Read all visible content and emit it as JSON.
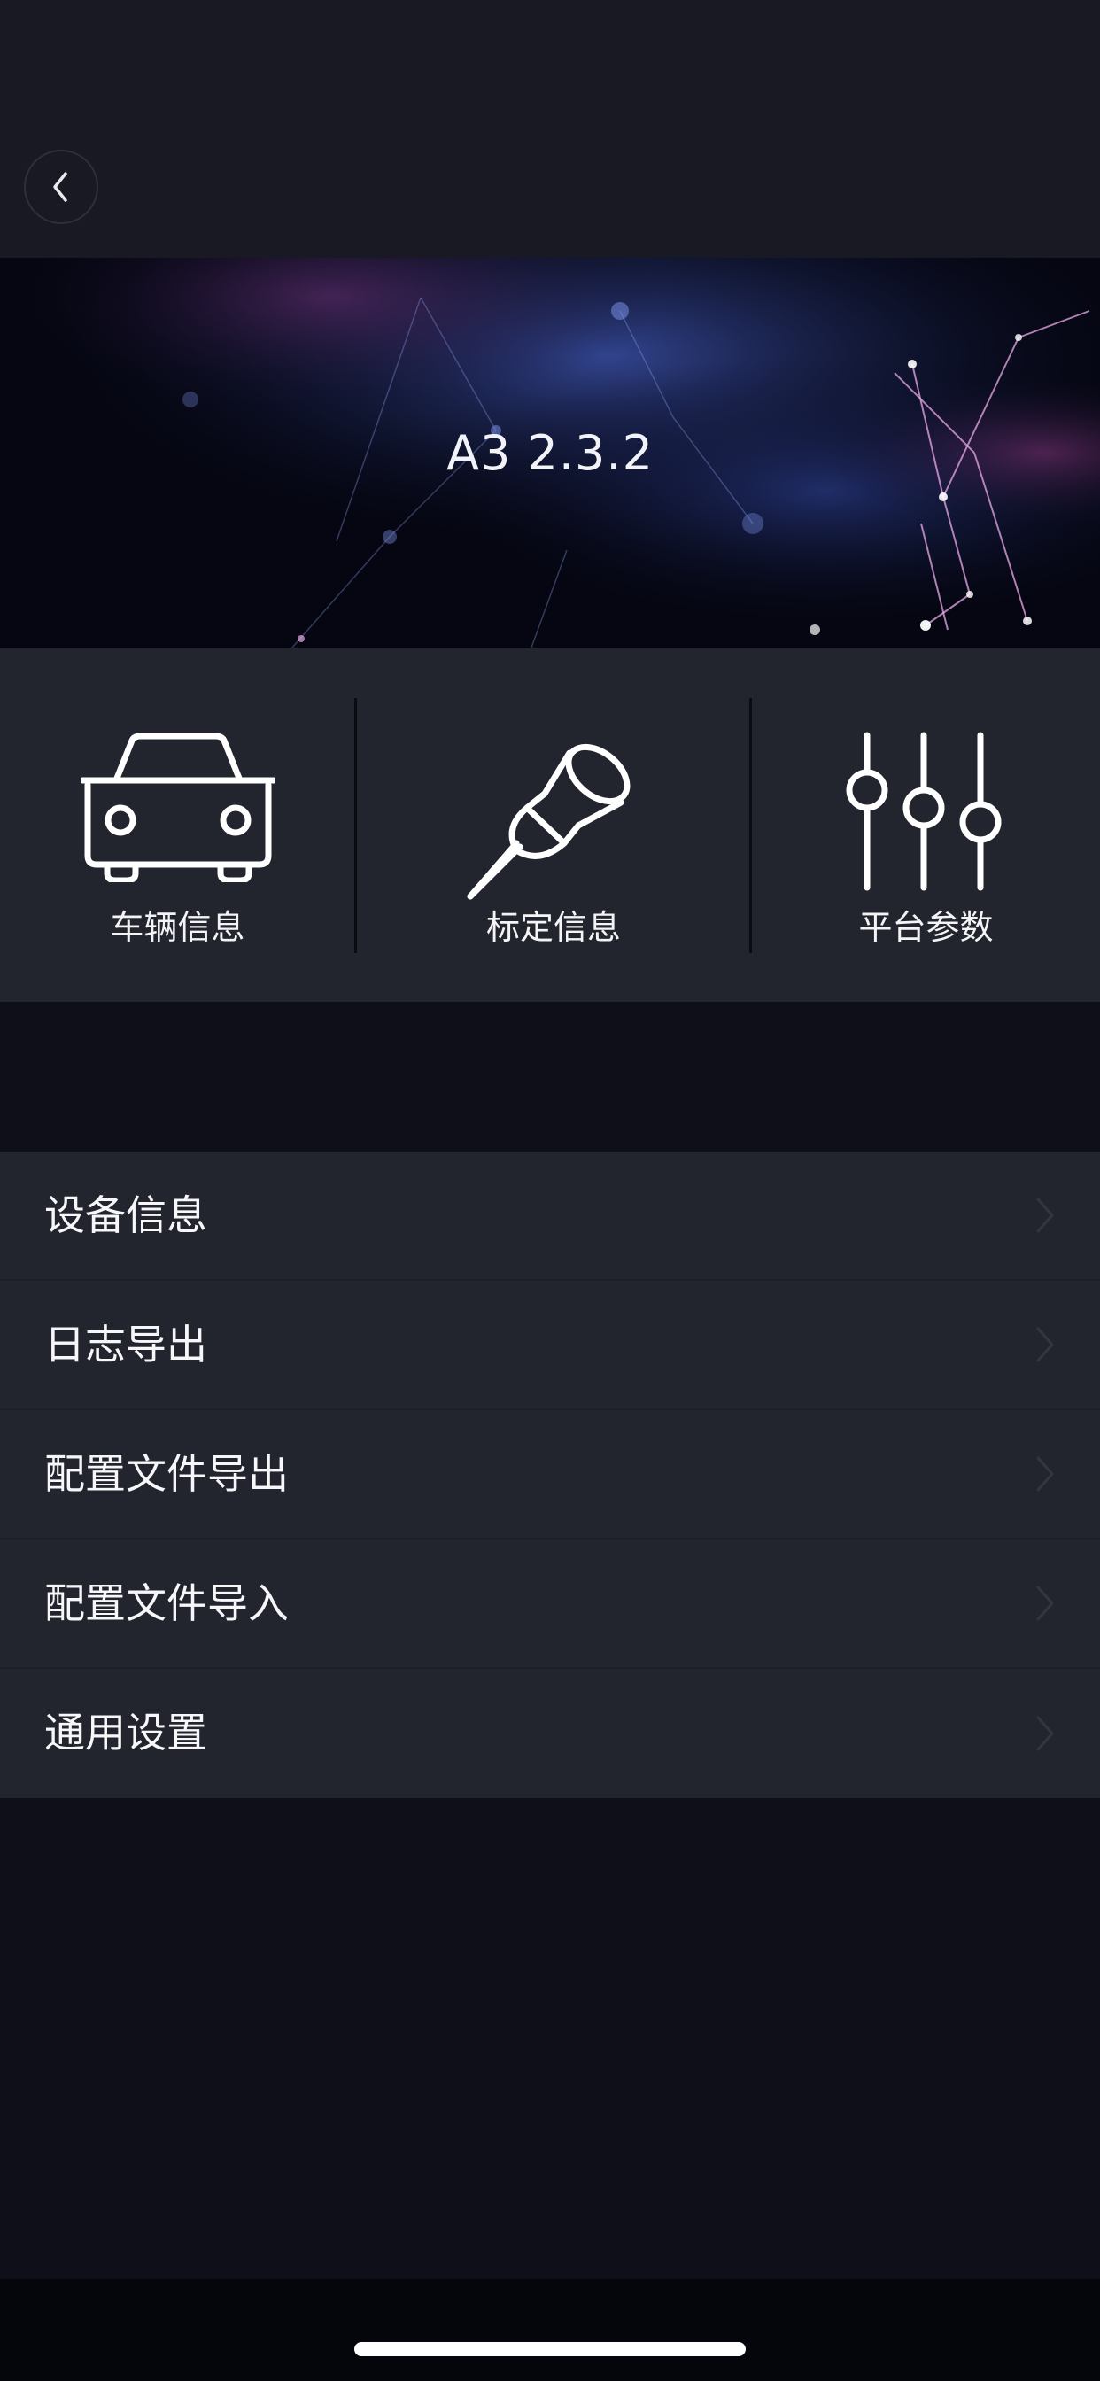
{
  "header": {
    "back_icon": "chevron-left-icon"
  },
  "banner": {
    "title": "A3 2.3.2"
  },
  "features": [
    {
      "label": "车辆信息",
      "icon": "car-icon"
    },
    {
      "label": "标定信息",
      "icon": "pushpin-icon"
    },
    {
      "label": "平台参数",
      "icon": "sliders-icon"
    }
  ],
  "menu": {
    "items": [
      {
        "label": "设备信息"
      },
      {
        "label": "日志导出"
      },
      {
        "label": "配置文件导出"
      },
      {
        "label": "配置文件导入"
      },
      {
        "label": "通用设置"
      }
    ],
    "chevron_icon": "chevron-right-icon"
  },
  "colors": {
    "background": "#0f0f1a",
    "topbar": "#181923",
    "panel": "#22242e",
    "text": "#ffffff"
  }
}
